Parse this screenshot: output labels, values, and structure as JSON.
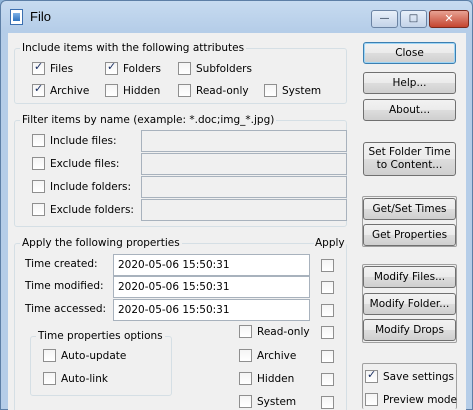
{
  "window": {
    "title": "Filo",
    "minimize": "—",
    "maximize": "□",
    "close": "✕"
  },
  "attributes": {
    "title": "Include items with the following attributes",
    "items": [
      {
        "label": "Files",
        "checked": true
      },
      {
        "label": "Folders",
        "checked": true
      },
      {
        "label": "Subfolders",
        "checked": false
      },
      {
        "label": "Archive",
        "checked": true
      },
      {
        "label": "Hidden",
        "checked": false
      },
      {
        "label": "Read-only",
        "checked": false
      },
      {
        "label": "System",
        "checked": false
      }
    ]
  },
  "filter": {
    "title": "Filter items by name (example: *.doc;img_*.jpg)",
    "rows": [
      {
        "label": "Include files:",
        "value": ""
      },
      {
        "label": "Exclude files:",
        "value": ""
      },
      {
        "label": "Include folders:",
        "value": ""
      },
      {
        "label": "Exclude folders:",
        "value": ""
      }
    ]
  },
  "properties": {
    "title": "Apply the following properties",
    "apply_header": "Apply",
    "times": [
      {
        "label": "Time created:",
        "value": "2020-05-06 15:50:31"
      },
      {
        "label": "Time modified:",
        "value": "2020-05-06 15:50:31"
      },
      {
        "label": "Time accessed:",
        "value": "2020-05-06 15:50:31"
      }
    ],
    "options_title": "Time properties options",
    "options": [
      {
        "label": "Auto-update",
        "checked": false
      },
      {
        "label": "Auto-link",
        "checked": false
      }
    ],
    "attrs": [
      {
        "label": "Read-only",
        "checked": false
      },
      {
        "label": "Archive",
        "checked": false
      },
      {
        "label": "Hidden",
        "checked": false
      },
      {
        "label": "System",
        "checked": false
      }
    ]
  },
  "buttons": {
    "close": "Close",
    "help": "Help...",
    "about": "About...",
    "set_folder_time_1": "Set Folder Time",
    "set_folder_time_2": "to Content...",
    "get_set_times": "Get/Set Times",
    "get_properties": "Get Properties",
    "modify_files": "Modify Files...",
    "modify_folder": "Modify Folder...",
    "modify_drops": "Modify Drops"
  },
  "settings": {
    "save": {
      "label": "Save settings",
      "checked": true
    },
    "preview": {
      "label": "Preview mode",
      "checked": false
    }
  }
}
